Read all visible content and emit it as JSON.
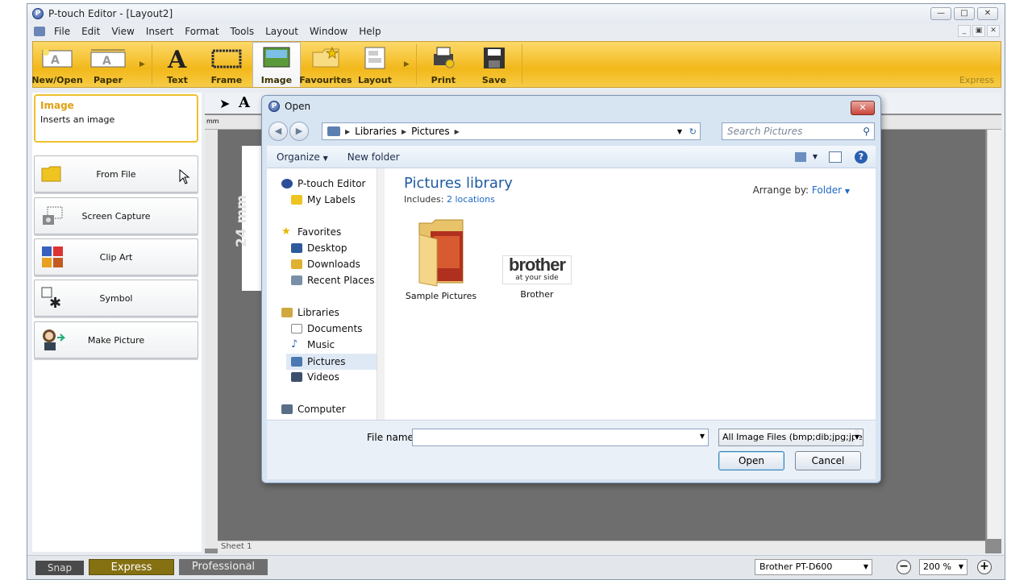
{
  "app": {
    "title": "P-touch Editor - [Layout2]",
    "menus": [
      "File",
      "Edit",
      "View",
      "Insert",
      "Format",
      "Tools",
      "Layout",
      "Window",
      "Help"
    ],
    "mode_label": "Express"
  },
  "ribbon": {
    "buttons": [
      {
        "label": "New/Open",
        "icon": "new-open-icon"
      },
      {
        "label": "Paper",
        "icon": "paper-icon"
      },
      {
        "label": "Text",
        "icon": "text-icon"
      },
      {
        "label": "Frame",
        "icon": "frame-icon"
      },
      {
        "label": "Image",
        "icon": "image-icon",
        "selected": true
      },
      {
        "label": "Favourites",
        "icon": "favourites-icon"
      },
      {
        "label": "Layout",
        "icon": "layout-icon"
      },
      {
        "label": "Print",
        "icon": "print-icon"
      },
      {
        "label": "Save",
        "icon": "save-icon"
      }
    ]
  },
  "left_panel": {
    "info_title": "Image",
    "info_desc": "Inserts an image",
    "buttons": [
      "From File",
      "Screen Capture",
      "Clip Art",
      "Symbol",
      "Make Picture"
    ]
  },
  "canvas": {
    "label_width": "24 mm",
    "sheet_tab": "Sheet 1",
    "ruler_unit": "mm"
  },
  "status": {
    "snap": "Snap",
    "express": "Express",
    "professional": "Professional",
    "printer": "Brother PT-D600",
    "zoom": "200 %"
  },
  "dialog": {
    "title": "Open",
    "breadcrumb": [
      "Libraries",
      "Pictures"
    ],
    "search_placeholder": "Search Pictures",
    "commands": [
      "Organize",
      "New folder"
    ],
    "nav": {
      "group1": [
        "P-touch Editor",
        "My Labels"
      ],
      "favorites_header": "Favorites",
      "favorites": [
        "Desktop",
        "Downloads",
        "Recent Places"
      ],
      "libraries_header": "Libraries",
      "libraries": [
        "Documents",
        "Music",
        "Pictures",
        "Videos"
      ],
      "computer": "Computer"
    },
    "library_title": "Pictures library",
    "includes_label": "Includes:",
    "includes_link": "2 locations",
    "arrange_label": "Arrange by:",
    "arrange_value": "Folder",
    "items": [
      {
        "name": "Sample Pictures",
        "icon": "folder-icon"
      },
      {
        "name": "Brother",
        "icon": "brother-logo"
      }
    ],
    "brother_logo_text": "brother",
    "brother_logo_sub": "at your side",
    "filename_label": "File name:",
    "filename_value": "",
    "filetype": "All Image Files (bmp;dib;jpg;jpe",
    "open_button": "Open",
    "cancel_button": "Cancel"
  }
}
